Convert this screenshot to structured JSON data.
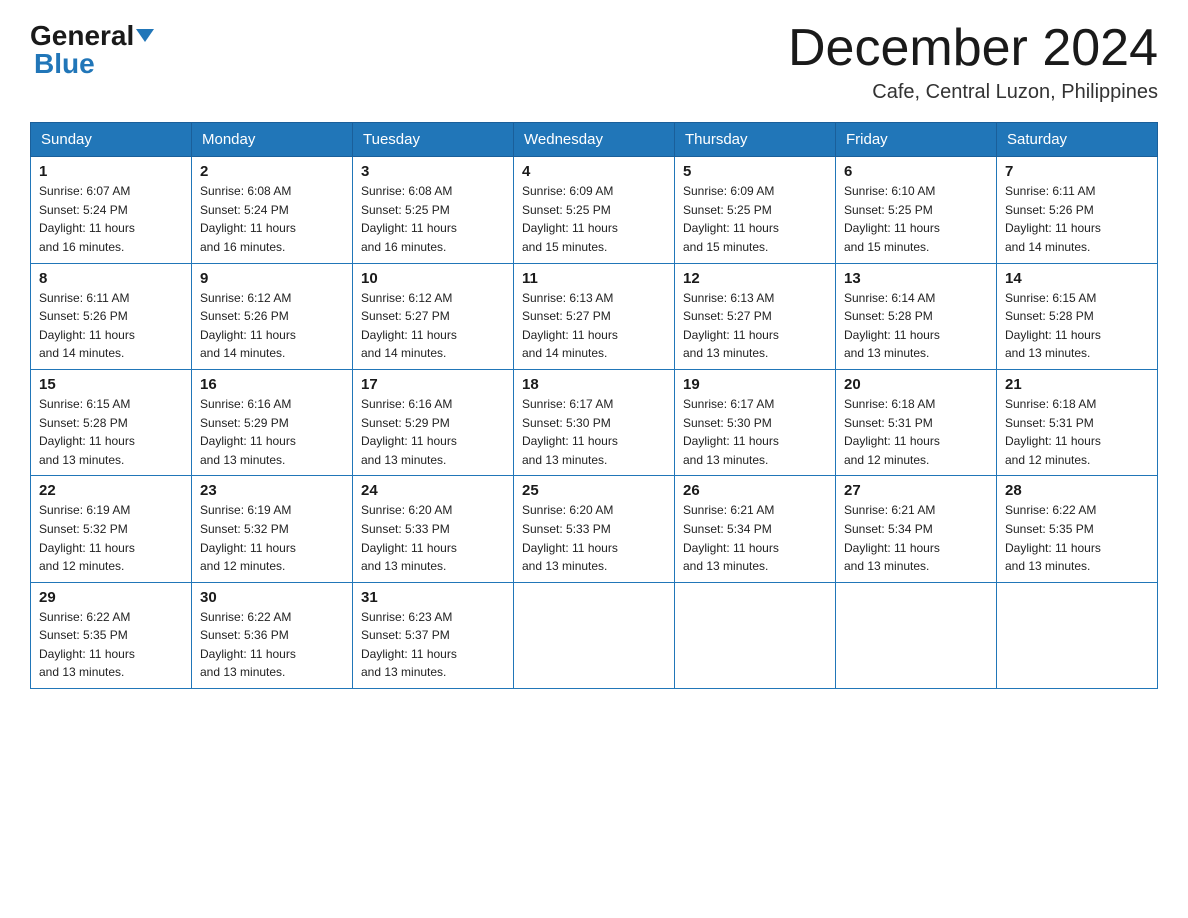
{
  "logo": {
    "general": "General",
    "blue": "Blue",
    "triangle": "▶"
  },
  "header": {
    "title": "December 2024",
    "subtitle": "Cafe, Central Luzon, Philippines"
  },
  "days": [
    "Sunday",
    "Monday",
    "Tuesday",
    "Wednesday",
    "Thursday",
    "Friday",
    "Saturday"
  ],
  "weeks": [
    [
      {
        "day": "1",
        "sunrise": "6:07 AM",
        "sunset": "5:24 PM",
        "daylight": "11 hours and 16 minutes."
      },
      {
        "day": "2",
        "sunrise": "6:08 AM",
        "sunset": "5:24 PM",
        "daylight": "11 hours and 16 minutes."
      },
      {
        "day": "3",
        "sunrise": "6:08 AM",
        "sunset": "5:25 PM",
        "daylight": "11 hours and 16 minutes."
      },
      {
        "day": "4",
        "sunrise": "6:09 AM",
        "sunset": "5:25 PM",
        "daylight": "11 hours and 15 minutes."
      },
      {
        "day": "5",
        "sunrise": "6:09 AM",
        "sunset": "5:25 PM",
        "daylight": "11 hours and 15 minutes."
      },
      {
        "day": "6",
        "sunrise": "6:10 AM",
        "sunset": "5:25 PM",
        "daylight": "11 hours and 15 minutes."
      },
      {
        "day": "7",
        "sunrise": "6:11 AM",
        "sunset": "5:26 PM",
        "daylight": "11 hours and 14 minutes."
      }
    ],
    [
      {
        "day": "8",
        "sunrise": "6:11 AM",
        "sunset": "5:26 PM",
        "daylight": "11 hours and 14 minutes."
      },
      {
        "day": "9",
        "sunrise": "6:12 AM",
        "sunset": "5:26 PM",
        "daylight": "11 hours and 14 minutes."
      },
      {
        "day": "10",
        "sunrise": "6:12 AM",
        "sunset": "5:27 PM",
        "daylight": "11 hours and 14 minutes."
      },
      {
        "day": "11",
        "sunrise": "6:13 AM",
        "sunset": "5:27 PM",
        "daylight": "11 hours and 14 minutes."
      },
      {
        "day": "12",
        "sunrise": "6:13 AM",
        "sunset": "5:27 PM",
        "daylight": "11 hours and 13 minutes."
      },
      {
        "day": "13",
        "sunrise": "6:14 AM",
        "sunset": "5:28 PM",
        "daylight": "11 hours and 13 minutes."
      },
      {
        "day": "14",
        "sunrise": "6:15 AM",
        "sunset": "5:28 PM",
        "daylight": "11 hours and 13 minutes."
      }
    ],
    [
      {
        "day": "15",
        "sunrise": "6:15 AM",
        "sunset": "5:28 PM",
        "daylight": "11 hours and 13 minutes."
      },
      {
        "day": "16",
        "sunrise": "6:16 AM",
        "sunset": "5:29 PM",
        "daylight": "11 hours and 13 minutes."
      },
      {
        "day": "17",
        "sunrise": "6:16 AM",
        "sunset": "5:29 PM",
        "daylight": "11 hours and 13 minutes."
      },
      {
        "day": "18",
        "sunrise": "6:17 AM",
        "sunset": "5:30 PM",
        "daylight": "11 hours and 13 minutes."
      },
      {
        "day": "19",
        "sunrise": "6:17 AM",
        "sunset": "5:30 PM",
        "daylight": "11 hours and 13 minutes."
      },
      {
        "day": "20",
        "sunrise": "6:18 AM",
        "sunset": "5:31 PM",
        "daylight": "11 hours and 12 minutes."
      },
      {
        "day": "21",
        "sunrise": "6:18 AM",
        "sunset": "5:31 PM",
        "daylight": "11 hours and 12 minutes."
      }
    ],
    [
      {
        "day": "22",
        "sunrise": "6:19 AM",
        "sunset": "5:32 PM",
        "daylight": "11 hours and 12 minutes."
      },
      {
        "day": "23",
        "sunrise": "6:19 AM",
        "sunset": "5:32 PM",
        "daylight": "11 hours and 12 minutes."
      },
      {
        "day": "24",
        "sunrise": "6:20 AM",
        "sunset": "5:33 PM",
        "daylight": "11 hours and 13 minutes."
      },
      {
        "day": "25",
        "sunrise": "6:20 AM",
        "sunset": "5:33 PM",
        "daylight": "11 hours and 13 minutes."
      },
      {
        "day": "26",
        "sunrise": "6:21 AM",
        "sunset": "5:34 PM",
        "daylight": "11 hours and 13 minutes."
      },
      {
        "day": "27",
        "sunrise": "6:21 AM",
        "sunset": "5:34 PM",
        "daylight": "11 hours and 13 minutes."
      },
      {
        "day": "28",
        "sunrise": "6:22 AM",
        "sunset": "5:35 PM",
        "daylight": "11 hours and 13 minutes."
      }
    ],
    [
      {
        "day": "29",
        "sunrise": "6:22 AM",
        "sunset": "5:35 PM",
        "daylight": "11 hours and 13 minutes."
      },
      {
        "day": "30",
        "sunrise": "6:22 AM",
        "sunset": "5:36 PM",
        "daylight": "11 hours and 13 minutes."
      },
      {
        "day": "31",
        "sunrise": "6:23 AM",
        "sunset": "5:37 PM",
        "daylight": "11 hours and 13 minutes."
      },
      null,
      null,
      null,
      null
    ]
  ],
  "labels": {
    "sunrise": "Sunrise:",
    "sunset": "Sunset:",
    "daylight": "Daylight:"
  },
  "colors": {
    "header_bg": "#2176b8",
    "border": "#2176b8"
  }
}
